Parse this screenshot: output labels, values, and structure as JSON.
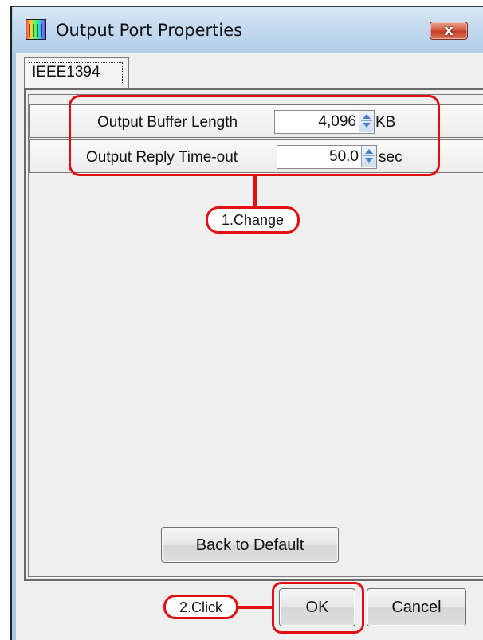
{
  "window": {
    "title": "Output Port Properties",
    "close_glyph": "x",
    "app_icon": "port-properties-icon"
  },
  "tabs": [
    {
      "label": "IEEE1394",
      "selected": true
    }
  ],
  "settings": {
    "buffer": {
      "label": "Output Buffer Length",
      "value": "4,096",
      "unit": "KB"
    },
    "reply": {
      "label": "Output Reply Time-out",
      "value": "50.0",
      "unit": "sec"
    }
  },
  "buttons": {
    "back_to_default": "Back to Default",
    "ok": "OK",
    "cancel": "Cancel"
  },
  "annotations": {
    "step1": "1.Change",
    "step2": "2.Click",
    "color": "#e01010"
  },
  "colors": {
    "frame": "#a9c7e6",
    "client": "#efefef",
    "close": "#c43a22"
  }
}
